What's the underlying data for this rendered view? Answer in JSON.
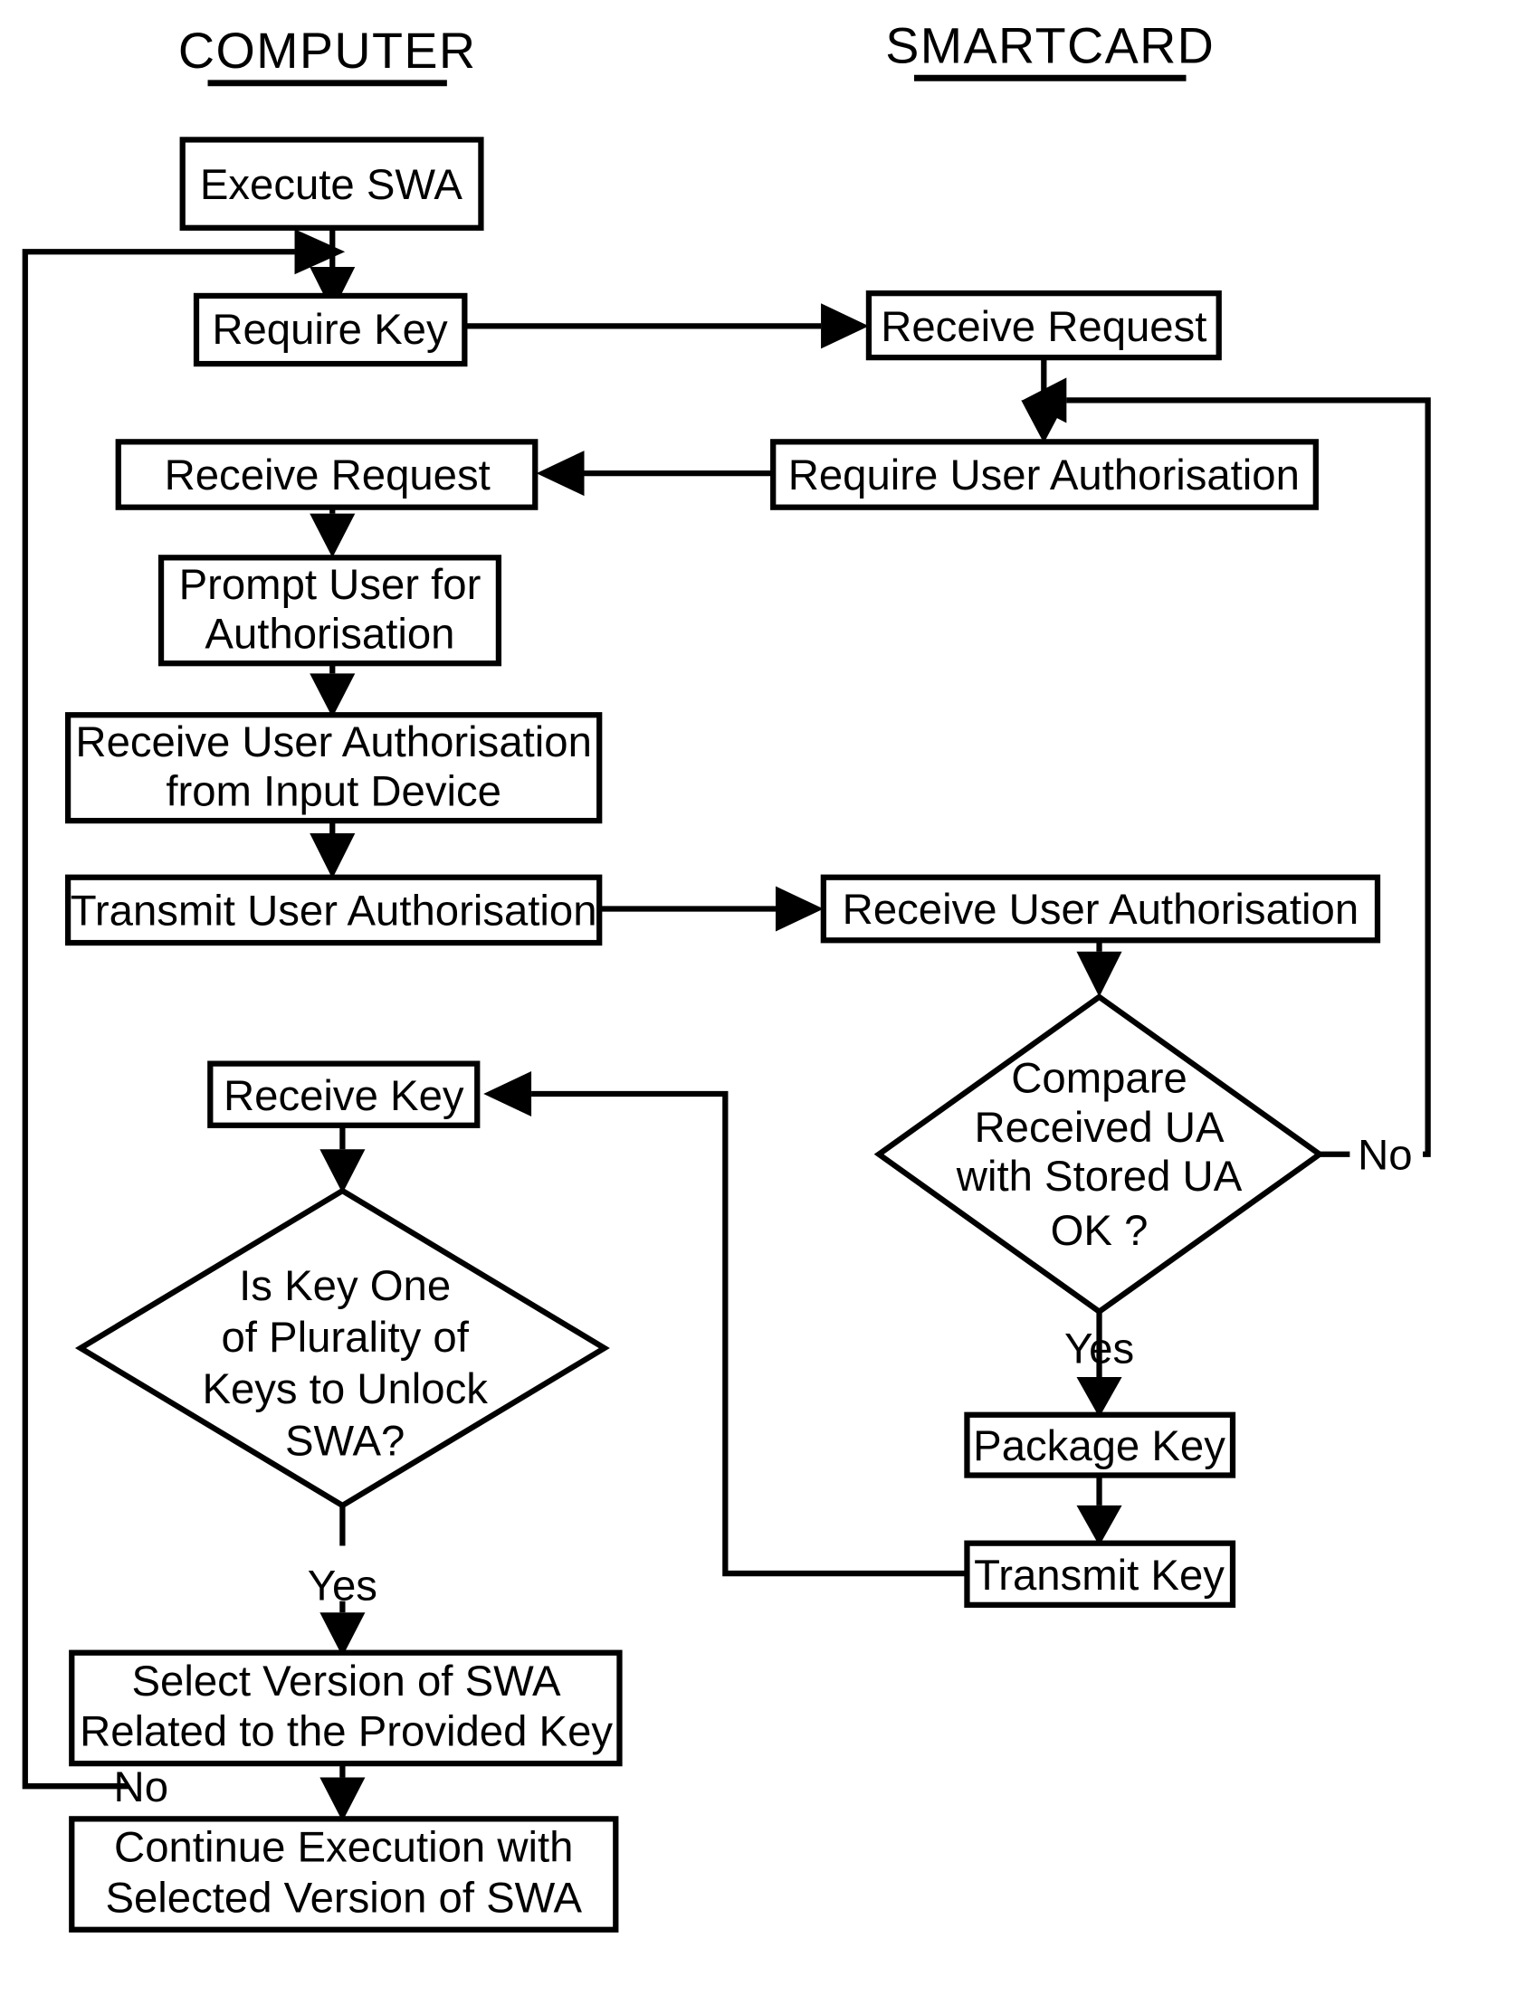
{
  "diagram": {
    "title_left": "COMPUTER",
    "title_right": "SMARTCARD",
    "colors": {
      "stroke": "#000000",
      "fill": "#ffffff",
      "text": "#000000"
    }
  },
  "lanes": [
    {
      "id": "computer",
      "label": "COMPUTER"
    },
    {
      "id": "smartcard",
      "label": "SMARTCARD"
    }
  ],
  "nodes": {
    "execute_swa": {
      "shape": "box",
      "lane": "computer",
      "lines": [
        "Execute SWA"
      ]
    },
    "require_key": {
      "shape": "box",
      "lane": "computer",
      "lines": [
        "Require Key"
      ]
    },
    "receive_request_left": {
      "shape": "box",
      "lane": "computer",
      "lines": [
        "Receive Request"
      ]
    },
    "prompt_user": {
      "shape": "box",
      "lane": "computer",
      "lines": [
        "Prompt User for",
        "Authorisation"
      ]
    },
    "receive_ua_input": {
      "shape": "box",
      "lane": "computer",
      "lines": [
        "Receive User Authorisation",
        "from Input Device"
      ]
    },
    "transmit_ua": {
      "shape": "box",
      "lane": "computer",
      "lines": [
        "Transmit User Authorisation"
      ]
    },
    "receive_key": {
      "shape": "box",
      "lane": "computer",
      "lines": [
        "Receive Key"
      ]
    },
    "is_key_one": {
      "shape": "diamond",
      "lane": "computer",
      "lines": [
        "Is Key One",
        "of Plurality of",
        "Keys to Unlock",
        "SWA?"
      ]
    },
    "select_version": {
      "shape": "box",
      "lane": "computer",
      "lines": [
        "Select Version of SWA",
        "Related to the Provided Key"
      ]
    },
    "continue_execution": {
      "shape": "box",
      "lane": "computer",
      "lines": [
        "Continue Execution with",
        "Selected Version of SWA"
      ]
    },
    "receive_request_right": {
      "shape": "box",
      "lane": "smartcard",
      "lines": [
        "Receive Request"
      ]
    },
    "require_user_auth": {
      "shape": "box",
      "lane": "smartcard",
      "lines": [
        "Require User Authorisation"
      ]
    },
    "receive_ua_right": {
      "shape": "box",
      "lane": "smartcard",
      "lines": [
        "Receive User Authorisation"
      ]
    },
    "compare_ua": {
      "shape": "diamond",
      "lane": "smartcard",
      "lines": [
        "Compare",
        "Received UA",
        "with Stored UA",
        "OK ?"
      ]
    },
    "package_key": {
      "shape": "box",
      "lane": "smartcard",
      "lines": [
        "Package Key"
      ]
    },
    "transmit_key": {
      "shape": "box",
      "lane": "smartcard",
      "lines": [
        "Transmit Key"
      ]
    }
  },
  "edge_labels": {
    "no_left_diamond": "No",
    "no_right_diamond": "No",
    "yes_left_diamond": "Yes",
    "yes_right_diamond": "Yes"
  },
  "edges": [
    {
      "from": "execute_swa",
      "to": "require_key",
      "label": ""
    },
    {
      "from": "require_key",
      "to": "receive_request_right",
      "label": ""
    },
    {
      "from": "receive_request_right",
      "to": "require_user_auth",
      "label": ""
    },
    {
      "from": "require_user_auth",
      "to": "receive_request_left",
      "label": ""
    },
    {
      "from": "receive_request_left",
      "to": "prompt_user",
      "label": ""
    },
    {
      "from": "prompt_user",
      "to": "receive_ua_input",
      "label": ""
    },
    {
      "from": "receive_ua_input",
      "to": "transmit_ua",
      "label": ""
    },
    {
      "from": "transmit_ua",
      "to": "receive_ua_right",
      "label": ""
    },
    {
      "from": "receive_ua_right",
      "to": "compare_ua",
      "label": ""
    },
    {
      "from": "compare_ua",
      "to": "package_key",
      "label": "Yes"
    },
    {
      "from": "compare_ua",
      "to": "receive_request_right",
      "label": "No"
    },
    {
      "from": "package_key",
      "to": "transmit_key",
      "label": ""
    },
    {
      "from": "transmit_key",
      "to": "receive_key",
      "label": ""
    },
    {
      "from": "receive_key",
      "to": "is_key_one",
      "label": ""
    },
    {
      "from": "is_key_one",
      "to": "select_version",
      "label": "Yes"
    },
    {
      "from": "is_key_one",
      "to": "require_key",
      "label": "No"
    },
    {
      "from": "select_version",
      "to": "continue_execution",
      "label": ""
    }
  ]
}
